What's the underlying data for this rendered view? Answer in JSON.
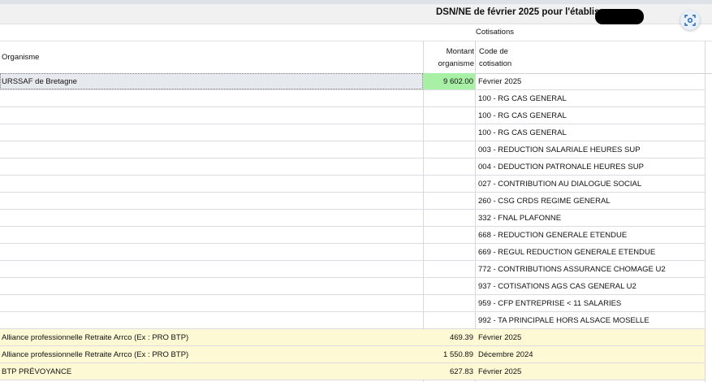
{
  "header": {
    "title": "DSN/NE de février 2025 pour l'établisseme",
    "subtitle": "Cotisations"
  },
  "columns": {
    "organisme": "Organisme",
    "montant_line1": "Montant",
    "montant_line2": "organisme",
    "code_line1": "Code de",
    "code_line2": "cotisation"
  },
  "rows": [
    {
      "organisme": "URSSAF de Bretagne",
      "montant": "9 602.00",
      "code": "Février 2025",
      "highlight": "green"
    },
    {
      "organisme": "",
      "montant": "",
      "code": "100 - RG CAS GENERAL"
    },
    {
      "organisme": "",
      "montant": "",
      "code": "100 - RG CAS GENERAL"
    },
    {
      "organisme": "",
      "montant": "",
      "code": "100 - RG CAS GENERAL"
    },
    {
      "organisme": "",
      "montant": "",
      "code": "003 - REDUCTION SALARIALE HEURES SUP"
    },
    {
      "organisme": "",
      "montant": "",
      "code": "004 - DEDUCTION PATRONALE HEURES SUP"
    },
    {
      "organisme": "",
      "montant": "",
      "code": "027 - CONTRIBUTION AU DIALOGUE SOCIAL"
    },
    {
      "organisme": "",
      "montant": "",
      "code": "260 - CSG CRDS REGIME GENERAL"
    },
    {
      "organisme": "",
      "montant": "",
      "code": "332 - FNAL PLAFONNE"
    },
    {
      "organisme": "",
      "montant": "",
      "code": "668 - REDUCTION GENERALE ETENDUE"
    },
    {
      "organisme": "",
      "montant": "",
      "code": "669 - REGUL REDUCTION GENERALE ETENDUE"
    },
    {
      "organisme": "",
      "montant": "",
      "code": "772 - CONTRIBUTIONS ASSURANCE CHOMAGE U2"
    },
    {
      "organisme": "",
      "montant": "",
      "code": "937 - COTISATIONS AGS CAS GENERAL U2"
    },
    {
      "organisme": "",
      "montant": "",
      "code": "959 - CFP ENTREPRISE < 11 SALARIES"
    },
    {
      "organisme": "",
      "montant": "",
      "code": "992 - TA PRINCIPALE HORS ALSACE MOSELLE"
    },
    {
      "organisme": "Alliance professionnelle Retraite Arrco (Ex : PRO BTP)",
      "montant": "469.39",
      "code": "Février 2025"
    },
    {
      "organisme": "Alliance professionnelle Retraite Arrco (Ex : PRO BTP)",
      "montant": "1 550.89",
      "code": "Décembre 2024"
    },
    {
      "organisme": "BTP PRÉVOYANCE",
      "montant": "627.83",
      "code": "Février 2025"
    }
  ],
  "icons": {
    "lens": "image-search-icon"
  },
  "colors": {
    "yellow_row": "#fdf9d5",
    "green_cell": "#a8f0a6",
    "selection": "#e6eaee"
  }
}
